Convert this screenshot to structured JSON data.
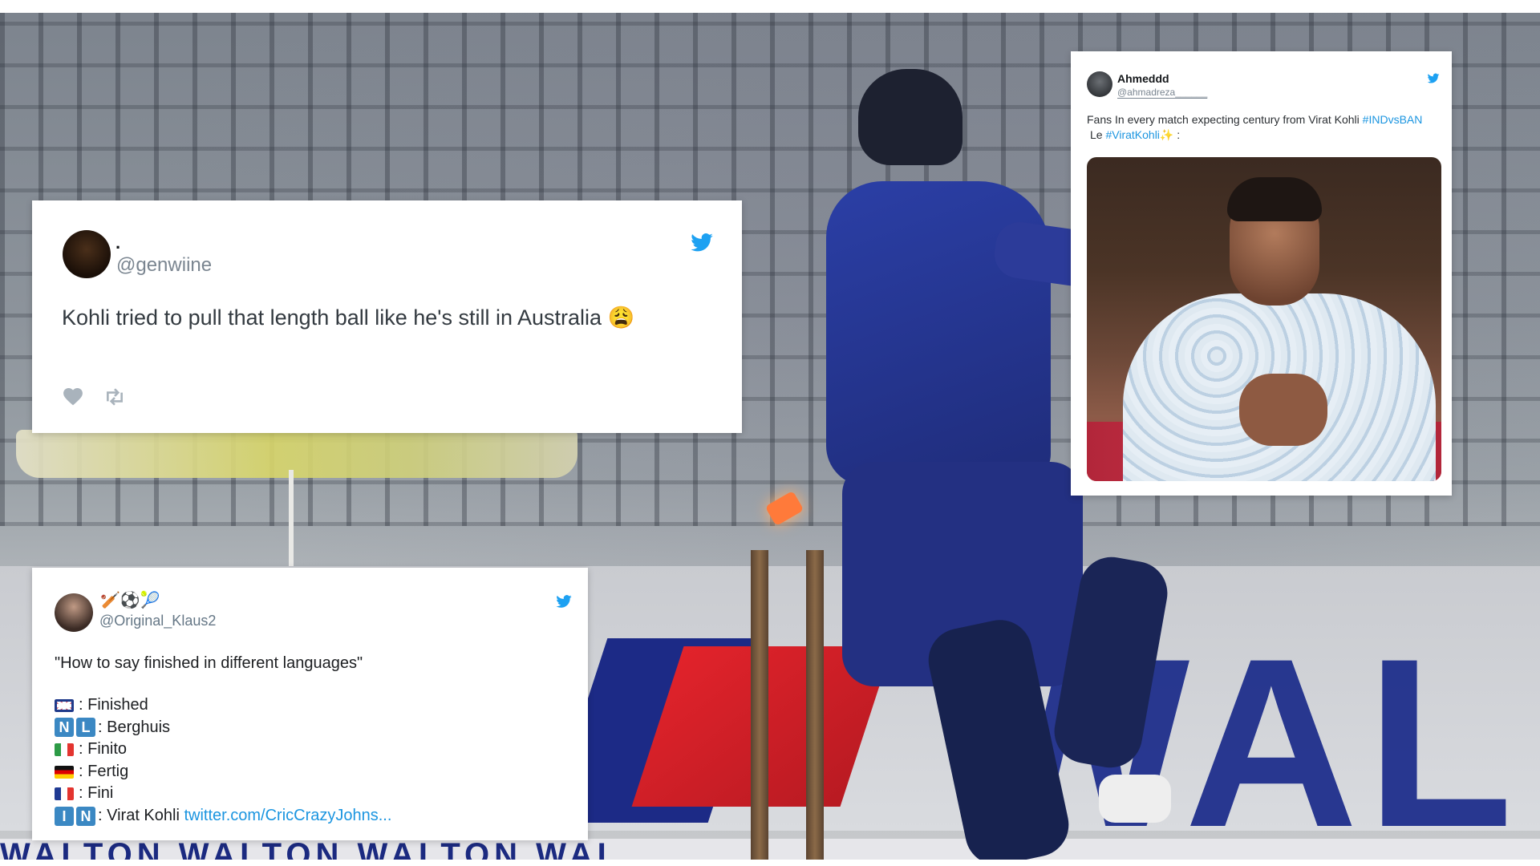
{
  "tweet1": {
    "name": ".",
    "handle": "@genwiine",
    "text": "Kohli tried to pull that length ball like he's still in Australia",
    "emoji": "😩",
    "bird_icon": "twitter-bird-icon",
    "brand_color": "#1da1f2"
  },
  "tweet2": {
    "name": "Ahmeddd",
    "handle": "@ahmadreza______",
    "text_line1_prefix": "Fans In every match expecting century from Virat Kohli ",
    "hashtag1": "#INDvsBAN",
    "text_line2_prefix": "Le ",
    "hashtag2": "#ViratKohli",
    "text_line2_suffix": "✨ :"
  },
  "tweet3": {
    "emojis": "🏏⚽🎾",
    "handle": "@Original_Klaus2",
    "quote": "\"How to say finished in different languages\"",
    "langs": {
      "uk": ": Finished",
      "nl_letters": [
        "N",
        "L"
      ],
      "nl": ": Berghuis",
      "it": ": Finito",
      "de": ": Fertig",
      "fr": ": Fini",
      "in_letters": [
        "I",
        "N"
      ],
      "in_text": ": Virat Kohli ",
      "in_link": "twitter.com/CricCrazyJohns..."
    }
  },
  "background": {
    "sponsor": "WAL",
    "strip_text": "WALTON   WALTON   WALTON   WAL"
  }
}
